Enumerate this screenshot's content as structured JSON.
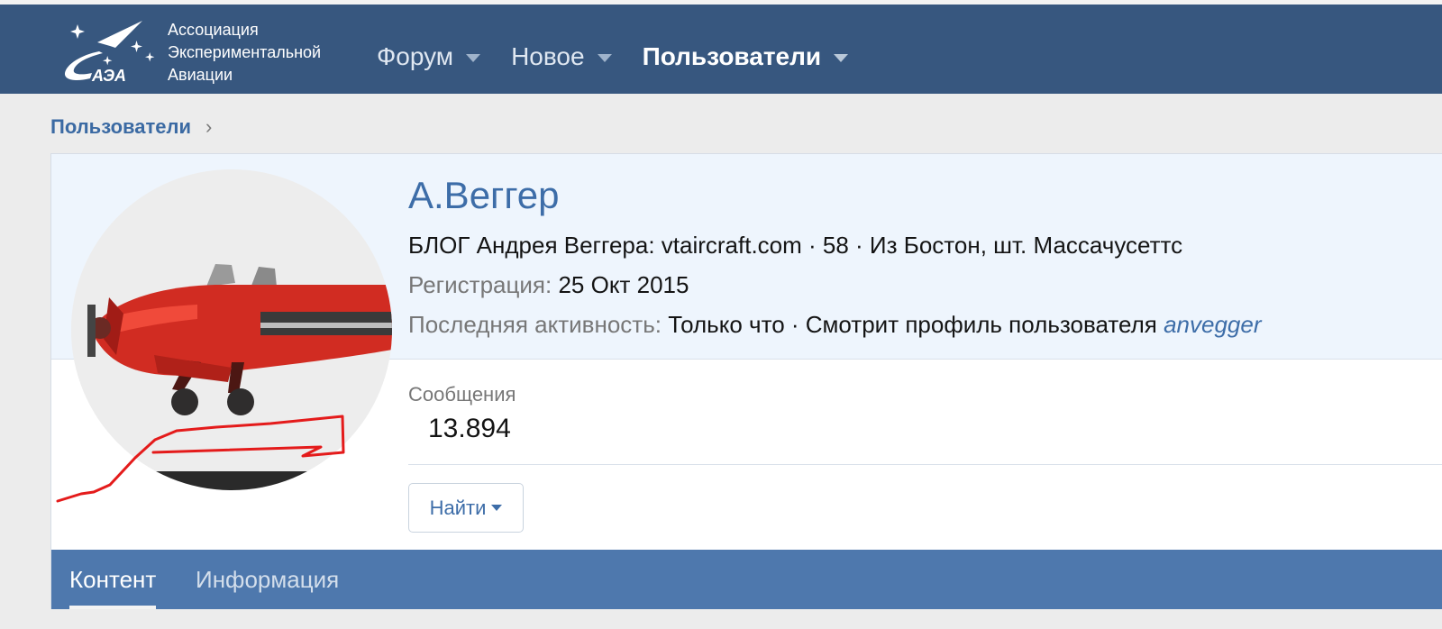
{
  "header": {
    "logo_lines": [
      "Ассоциация",
      "Экспериментальной",
      "Авиации"
    ],
    "logo_mark": "АЭА",
    "nav": [
      {
        "label": "Форум"
      },
      {
        "label": "Новое"
      },
      {
        "label": "Пользователи"
      }
    ],
    "active_nav": "Пользователи"
  },
  "breadcrumb": {
    "label": "Пользователи"
  },
  "profile": {
    "name": "А.Веггер",
    "blurb": "БЛОГ Андрея Веггера: vtaircraft.com · 58 · Из Бостон, шт. Массачусеттс",
    "registered_label": "Регистрация:",
    "registered_value": "25 Окт 2015",
    "last_active_label": "Последняя активность:",
    "last_active_value": "Только что · Смотрит профиль пользователя",
    "last_active_user": "anvegger",
    "stat_label": "Сообщения",
    "stat_value": "13.894",
    "find_button": "Найти"
  },
  "tabs": [
    {
      "label": "Контент"
    },
    {
      "label": "Информация"
    }
  ],
  "active_tab": "Контент",
  "colors": {
    "header_bg": "#37577f",
    "accent": "#3d6da8",
    "tabs_bg": "#4e78ad",
    "annotation": "#e41b1b"
  }
}
